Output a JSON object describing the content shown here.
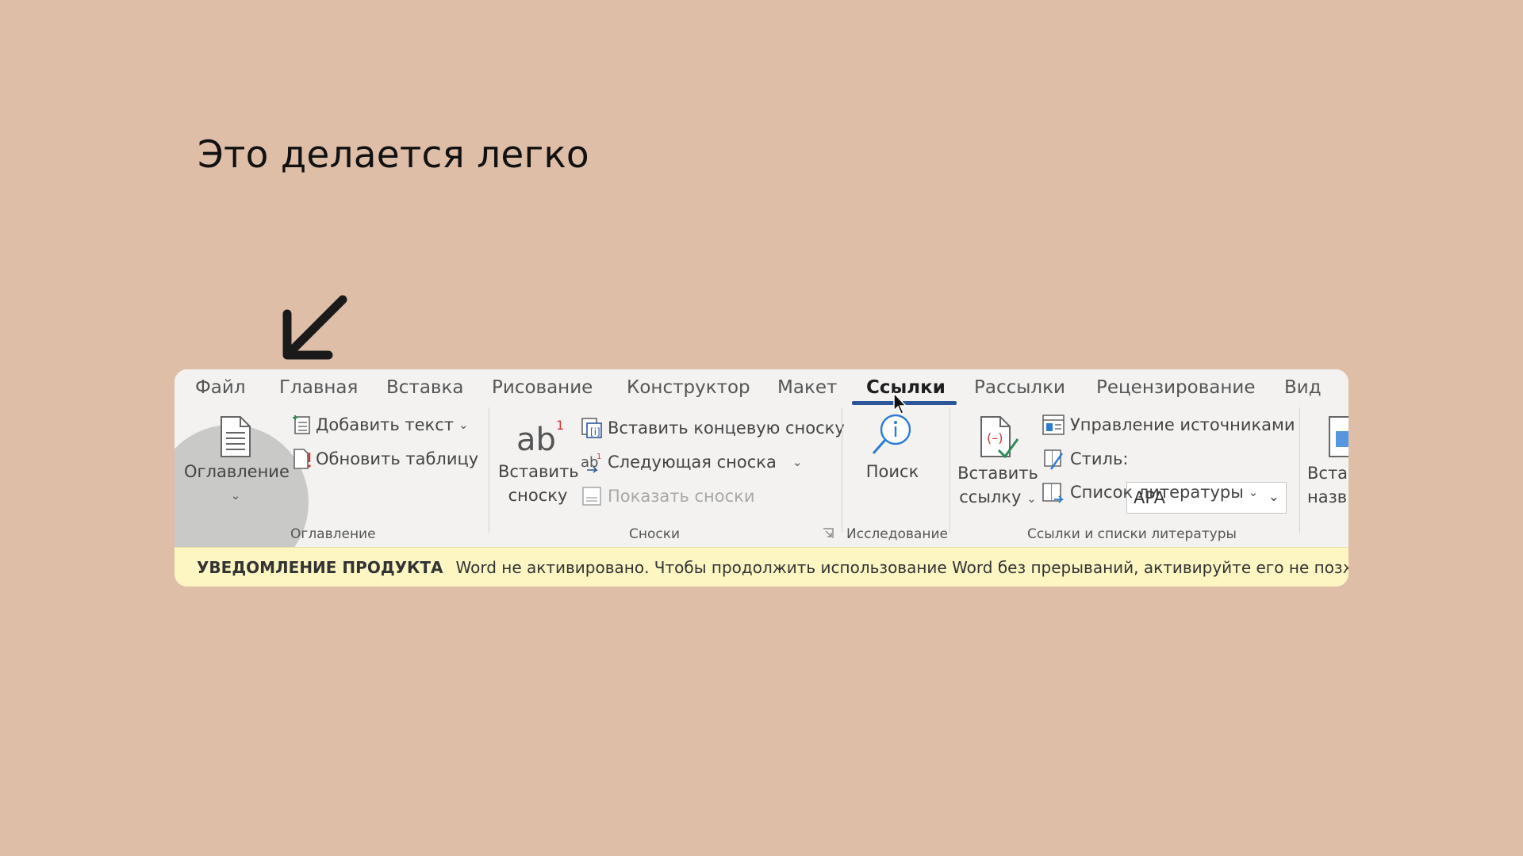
{
  "headline": "Это делается легко",
  "tabs": [
    {
      "label": "Файл"
    },
    {
      "label": "Главная"
    },
    {
      "label": "Вставка"
    },
    {
      "label": "Рисование"
    },
    {
      "label": "Конструктор"
    },
    {
      "label": "Макет"
    },
    {
      "label": "Ссылки",
      "active": true
    },
    {
      "label": "Рассылки"
    },
    {
      "label": "Рецензирование"
    },
    {
      "label": "Вид"
    }
  ],
  "groups": {
    "toc": {
      "label": "Оглавление",
      "main_button": "Оглавление",
      "add_text": "Добавить текст",
      "update_table": "Обновить таблицу"
    },
    "footnotes": {
      "label": "Сноски",
      "insert_footnote_line1": "Вставить",
      "insert_footnote_line2": "сноску",
      "insert_endnote": "Вставить концевую сноску",
      "next_footnote": "Следующая сноска",
      "show_notes": "Показать сноски"
    },
    "research": {
      "label": "Исследование",
      "search": "Поиск"
    },
    "citations": {
      "label": "Ссылки и списки литературы",
      "insert_citation_line1": "Вставить",
      "insert_citation_line2": "ссылку",
      "manage_sources": "Управление источниками",
      "style_label": "Стиль:",
      "style_value": "APA",
      "bibliography": "Список литературы"
    },
    "captions": {
      "insert_caption_line1": "Вста",
      "insert_caption_line2": "назв"
    }
  },
  "notice": {
    "title": "УВЕДОМЛЕНИЕ ПРОДУКТА",
    "message": "Word не активировано. Чтобы продолжить использование Word без прерываний, активируйте его не позже"
  },
  "colors": {
    "background": "#dfbea8",
    "accent": "#2b579a",
    "notice_bg": "#fdf6c3"
  }
}
